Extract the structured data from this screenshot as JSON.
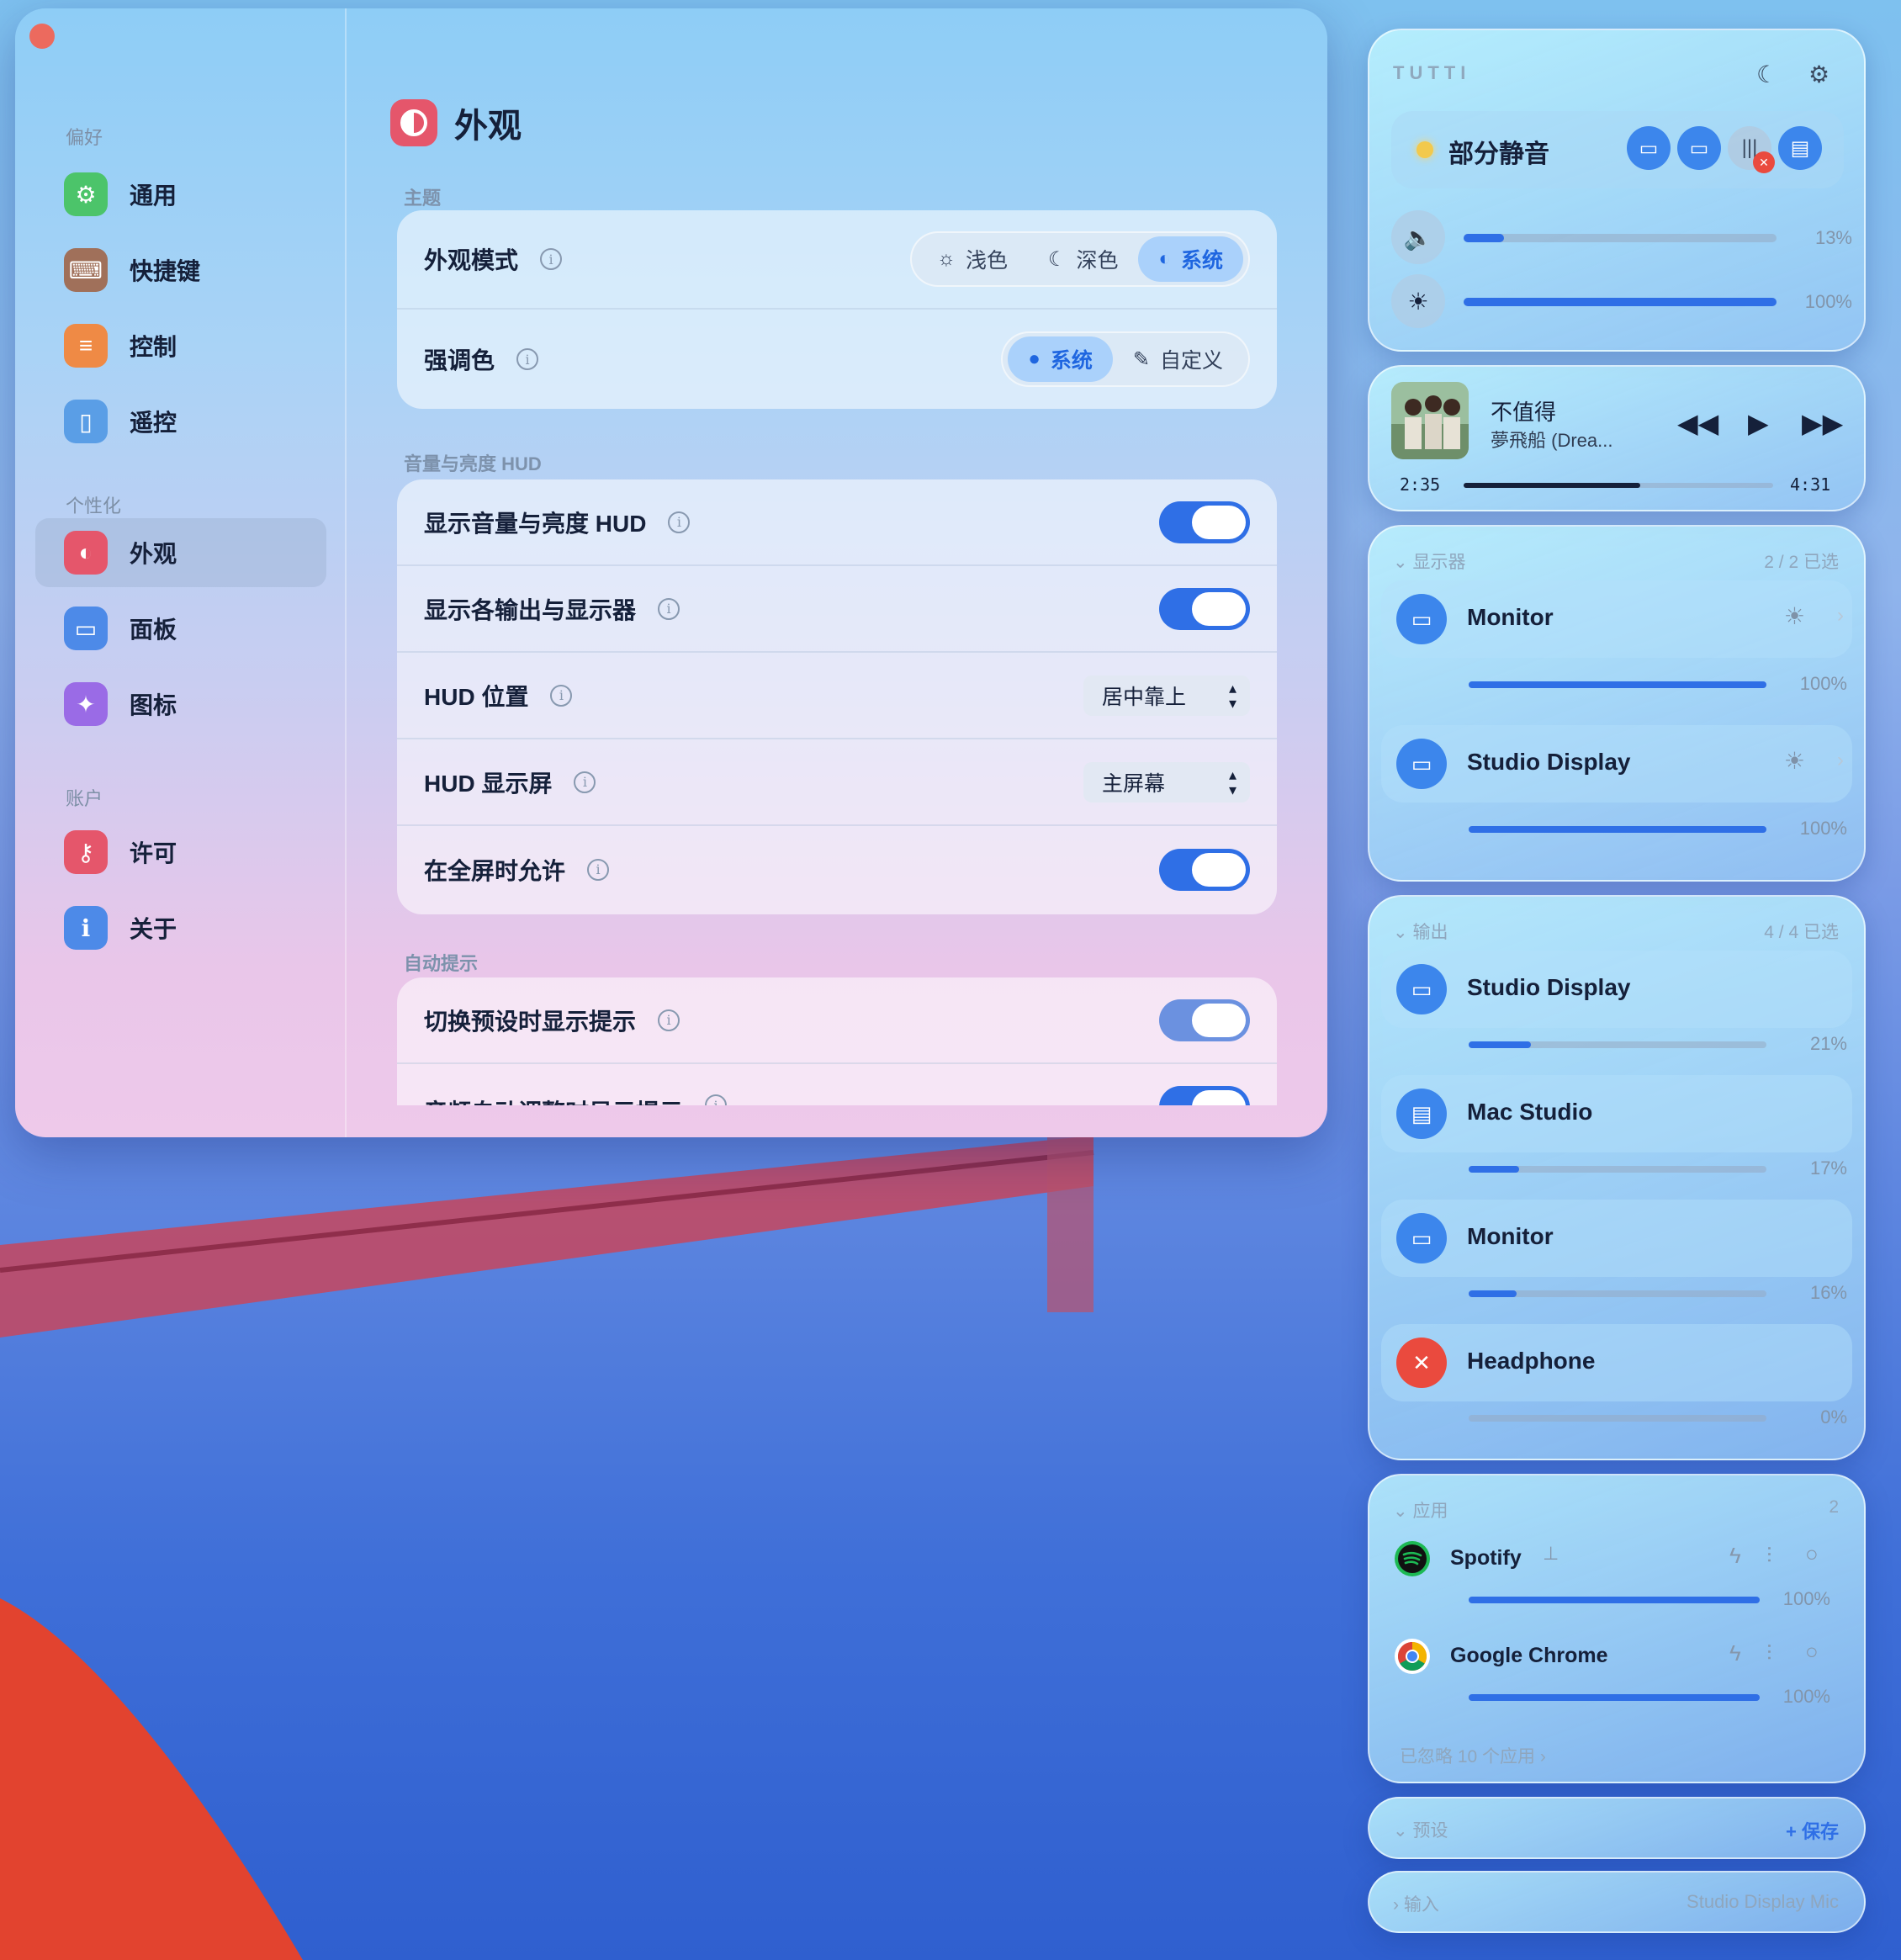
{
  "window": {
    "sidebar": {
      "sections": [
        {
          "title": "偏好",
          "items": [
            {
              "label": "通用",
              "icon": "gear-icon",
              "color": "#4cc46a"
            },
            {
              "label": "快捷键",
              "icon": "keyboard-icon",
              "color": "#a0705a"
            },
            {
              "label": "控制",
              "icon": "sliders-icon",
              "color": "#ef8a45"
            },
            {
              "label": "遥控",
              "icon": "remote-icon",
              "color": "#5a9ee6"
            }
          ]
        },
        {
          "title": "个性化",
          "items": [
            {
              "label": "外观",
              "icon": "appearance-icon",
              "color": "#e5566b"
            },
            {
              "label": "面板",
              "icon": "panel-icon",
              "color": "#4d8ae8"
            },
            {
              "label": "图标",
              "icon": "sparkle-icon",
              "color": "#9a6be6"
            }
          ]
        },
        {
          "title": "账户",
          "items": [
            {
              "label": "许可",
              "icon": "key-icon",
              "color": "#e5566b"
            },
            {
              "label": "关于",
              "icon": "info-icon",
              "color": "#4d8ae8"
            }
          ]
        }
      ]
    },
    "page_title": "外观",
    "theme": {
      "section": "主题",
      "mode_label": "外观模式",
      "mode_options": [
        "浅色",
        "深色",
        "系统"
      ],
      "mode_selected": "系统",
      "accent_label": "强调色",
      "accent_options": [
        "系统",
        "自定义"
      ],
      "accent_selected": "系统"
    },
    "hud": {
      "section": "音量与亮度 HUD",
      "show_hud": "显示音量与亮度 HUD",
      "show_outputs": "显示各输出与显示器",
      "position_label": "HUD 位置",
      "position_value": "居中靠上",
      "screen_label": "HUD 显示屏",
      "screen_value": "主屏幕",
      "fullscreen_label": "在全屏时允许"
    },
    "auto_hint": {
      "section": "自动提示",
      "preset_hint": "切换预设时显示提示",
      "cut_row": "音频自动调整时显示提示"
    }
  },
  "tutti": {
    "brand": "TUTTI",
    "mute_status": "部分静音",
    "volume_pct": "13%",
    "volume_value": 0.13,
    "brightness_pct": "100%",
    "brightness_value": 1.0,
    "now_playing": {
      "title": "不值得",
      "artist": "夢飛船 (Drea...",
      "elapsed": "2:35",
      "duration": "4:31",
      "progress": 0.57
    },
    "displays": {
      "header": "显示器",
      "count": "2 / 2 已选",
      "items": [
        {
          "name": "Monitor",
          "pct": "100%",
          "value": 1.0
        },
        {
          "name": "Studio Display",
          "pct": "100%",
          "value": 1.0
        }
      ]
    },
    "outputs": {
      "header": "输出",
      "count": "4 / 4 已选",
      "items": [
        {
          "name": "Studio Display",
          "pct": "21%",
          "value": 0.21
        },
        {
          "name": "Mac Studio",
          "pct": "17%",
          "value": 0.17
        },
        {
          "name": "Monitor",
          "pct": "16%",
          "value": 0.16
        },
        {
          "name": "Headphone",
          "pct": "0%",
          "value": 0.0
        }
      ]
    },
    "apps": {
      "header": "应用",
      "count": "2",
      "items": [
        {
          "name": "Spotify",
          "pct": "100%",
          "value": 1.0
        },
        {
          "name": "Google Chrome",
          "pct": "100%",
          "value": 1.0
        }
      ],
      "ignored": "已忽略 10 个应用"
    },
    "presets": {
      "header": "预设",
      "save": "保存"
    },
    "input": {
      "header": "输入",
      "device": "Studio Display Mic"
    }
  }
}
